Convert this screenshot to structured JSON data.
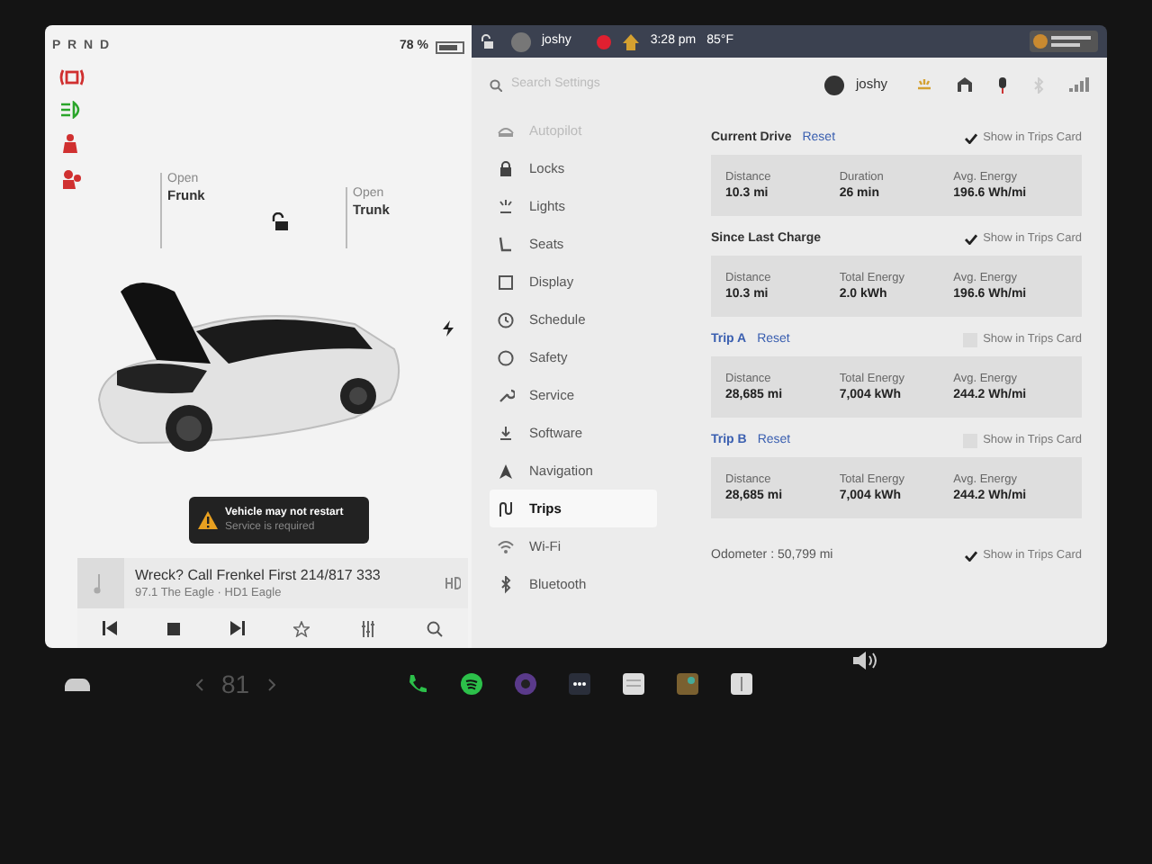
{
  "status": {
    "gear": "P R N D",
    "battery_percent": "78 %"
  },
  "vehicle": {
    "frunk": {
      "action": "Open",
      "label": "Frunk"
    },
    "trunk": {
      "action": "Open",
      "label": "Trunk"
    },
    "locked": false
  },
  "alert": {
    "title": "Vehicle may not restart",
    "message": "Service is required"
  },
  "media": {
    "title": "Wreck? Call Frenkel First 214/817 333",
    "station": "97.1 The Eagle · HD1 Eagle"
  },
  "top_bar": {
    "user": "joshy",
    "time": "3:28 pm",
    "temperature": "85°F"
  },
  "settings": {
    "search": {
      "placeholder": "Search Settings"
    },
    "user": "joshy",
    "menu": [
      {
        "label": "Autopilot",
        "kind": "autopilot",
        "selected": false,
        "disabled": true
      },
      {
        "label": "Locks",
        "kind": "lock",
        "selected": false,
        "disabled": false
      },
      {
        "label": "Lights",
        "kind": "light",
        "selected": false,
        "disabled": false
      },
      {
        "label": "Seats",
        "kind": "seat",
        "selected": false,
        "disabled": false
      },
      {
        "label": "Display",
        "kind": "display",
        "selected": false,
        "disabled": false
      },
      {
        "label": "Schedule",
        "kind": "schedule",
        "selected": false,
        "disabled": false
      },
      {
        "label": "Safety",
        "kind": "safety",
        "selected": false,
        "disabled": false
      },
      {
        "label": "Service",
        "kind": "service",
        "selected": false,
        "disabled": false
      },
      {
        "label": "Software",
        "kind": "software",
        "selected": false,
        "disabled": false
      },
      {
        "label": "Navigation",
        "kind": "navigation",
        "selected": false,
        "disabled": false
      },
      {
        "label": "Trips",
        "kind": "trips",
        "selected": true,
        "disabled": false
      },
      {
        "label": "Wi-Fi",
        "kind": "wifi",
        "selected": false,
        "disabled": false
      },
      {
        "label": "Bluetooth",
        "kind": "bluetooth",
        "selected": false,
        "disabled": false
      }
    ],
    "sections": [
      {
        "title": "Current Drive",
        "reset": "Reset",
        "show_label": "Show in Trips Card",
        "checked": true,
        "stats": [
          {
            "label": "Distance",
            "value": "10.3 mi"
          },
          {
            "label": "Duration",
            "value": "26 min"
          },
          {
            "label": "Avg. Energy",
            "value": "196.6 Wh/mi"
          }
        ]
      },
      {
        "title": "Since Last Charge",
        "show_label": "Show in Trips Card",
        "checked": true,
        "stats": [
          {
            "label": "Distance",
            "value": "10.3 mi"
          },
          {
            "label": "Total Energy",
            "value": "2.0 kWh"
          },
          {
            "label": "Avg. Energy",
            "value": "196.6 Wh/mi"
          }
        ]
      },
      {
        "title": "Trip A",
        "reset": "Reset",
        "show_label": "Show in Trips Card",
        "checked": false,
        "stats": [
          {
            "label": "Distance",
            "value": "28,685 mi"
          },
          {
            "label": "Total Energy",
            "value": "7,004 kWh"
          },
          {
            "label": "Avg. Energy",
            "value": "244.2 Wh/mi"
          }
        ]
      },
      {
        "title": "Trip B",
        "reset": "Reset",
        "show_label": "Show in Trips Card",
        "checked": false,
        "stats": [
          {
            "label": "Distance",
            "value": "28,685 mi"
          },
          {
            "label": "Total Energy",
            "value": "7,004 kWh"
          },
          {
            "label": "Avg. Energy",
            "value": "244.2 Wh/mi"
          }
        ]
      }
    ],
    "odometer": {
      "text": "Odometer : 50,799 mi",
      "show_label": "Show in Trips Card",
      "checked": true
    }
  },
  "taskbar": {
    "temperature": "81"
  }
}
